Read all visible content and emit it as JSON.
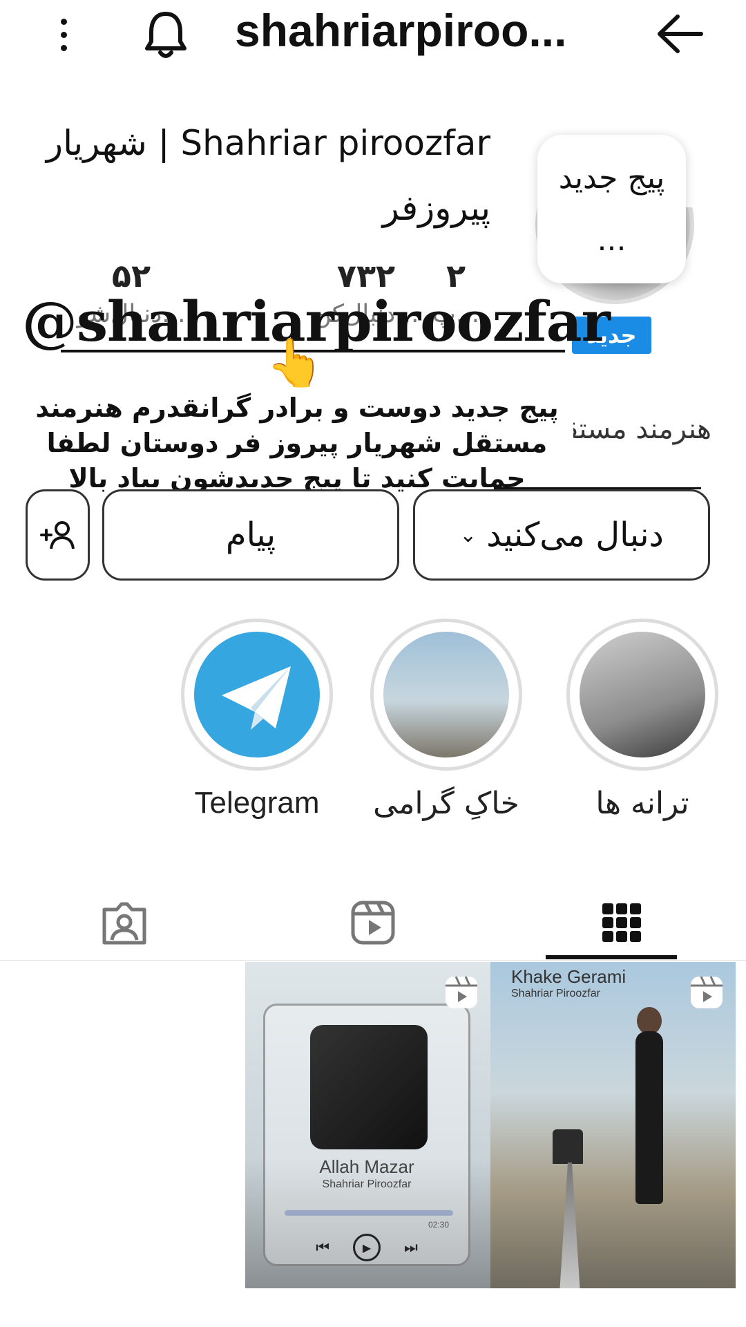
{
  "topbar": {
    "username": "shahriarpiroo...",
    "menu_icon": "more-vertical-icon",
    "bell_icon": "bell-icon",
    "back_icon": "arrow-right-icon"
  },
  "profile": {
    "full_name": "Shahriar piroozfar | شهریار پیروزفر",
    "note": "پیج جدید ...",
    "new_badge": "جدید",
    "stats": [
      {
        "value": "۵۲",
        "label": "دنبال‌شو..."
      },
      {
        "value": "۷۳۲",
        "label": "دنبال‌کن..."
      },
      {
        "value": "۲",
        "label": "پ..."
      }
    ],
    "bio_snippet": "هنرمند مستقل"
  },
  "overlay": {
    "handle": "@shahriarpiroozfar",
    "pointer_emoji": "👆",
    "text": "پیج جدید دوست و برادر گرانقدرم هنرمند مستقل شهریار پیروز فر دوستان لطفا حمایت کنید تا پیج جدیدشون بیاد بالا"
  },
  "actions": {
    "following_label": "دنبال می‌کنید",
    "following_chevron": "⌄",
    "message_label": "پیام",
    "add_user_icon": "add-user-icon"
  },
  "highlights": [
    {
      "label": "ترانه ها"
    },
    {
      "label": "خاکِ گرامی"
    },
    {
      "label": "Telegram"
    }
  ],
  "tabs": [
    "grid-icon",
    "reels-icon",
    "tagged-icon"
  ],
  "posts": [
    {
      "title": "Khake Gerami",
      "subtitle": "Shahriar Piroozfar"
    },
    {
      "song": "Allah Mazar",
      "artist": "Shahriar Piroozfar",
      "time": "02:30"
    }
  ],
  "colors": {
    "accent": "#1a8ce6",
    "telegram": "#35a6e0"
  }
}
